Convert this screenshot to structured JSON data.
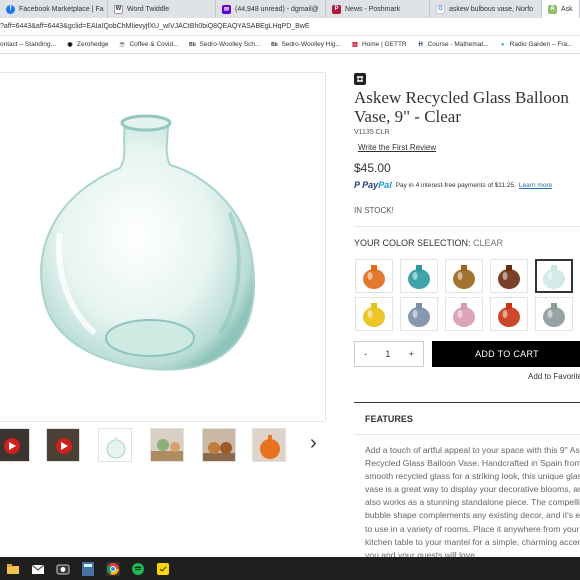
{
  "browser": {
    "tabs": [
      {
        "label": "Facebook Marketplace | Fa",
        "color": "#1877f2",
        "glyph": "f"
      },
      {
        "label": "Word Twiddle",
        "color": "#ffffff",
        "glyph": "W"
      },
      {
        "label": "(44,948 unread) - dgmail@",
        "color": "#6001d2",
        "glyph": "✉"
      },
      {
        "label": "News - Poshmark",
        "color": "#ac1a3a",
        "glyph": "P"
      },
      {
        "label": "askew bulbous vase, Norfo",
        "color": "#fbbc05",
        "glyph": "G"
      },
      {
        "label": "Ask",
        "color": "#8fbf6a",
        "glyph": "A"
      }
    ],
    "url": "?aff=6443&aff=6443&gclid=EAIaIQobChMIievyjfXU_wIVJACtBh0biQ8QEAQYASABEgLHqPD_BwE",
    "bookmarks": [
      {
        "label": "ontact – Standing..."
      },
      {
        "label": "Zerohedge"
      },
      {
        "label": "Coffee & Covid..."
      },
      {
        "label": "Sedro-Woolley Sch..."
      },
      {
        "label": "Sedro-Woolley Hig..."
      },
      {
        "label": "Home | GETTR"
      },
      {
        "label": "Course - Mathemat..."
      },
      {
        "label": "Radio Garden – Fra..."
      }
    ]
  },
  "product": {
    "title_line1": "Askew Recycled Glass Balloon",
    "title_line2": "Vase, 9\" - Clear",
    "sku": "V1135 CLR",
    "review_link": "Write the First Review",
    "price": "$45.00",
    "paypal_text": "Pay in 4 interest-free payments of $11.25.",
    "paypal_link": "Learn more",
    "stock": "IN STOCK!",
    "color_label": "YOUR COLOR SELECTION:",
    "color_value": "CLEAR",
    "swatches": [
      {
        "color": "#e06a1a",
        "selected": false
      },
      {
        "color": "#2a9aa0",
        "selected": false
      },
      {
        "color": "#9a6418",
        "selected": false
      },
      {
        "color": "#6a2c10",
        "selected": false
      },
      {
        "color": "#cfe8e4",
        "selected": true
      },
      {
        "color": "#e8c012",
        "selected": false
      },
      {
        "color": "#7a8ea8",
        "selected": false
      },
      {
        "color": "#d89ab0",
        "selected": false
      },
      {
        "color": "#c83414",
        "selected": false
      },
      {
        "color": "#8a9a98",
        "selected": false
      }
    ],
    "qty_minus": "-",
    "qty_value": "1",
    "qty_plus": "+",
    "add_to_cart": "ADD TO CART",
    "add_to_favorites": "Add to Favorites",
    "features_heading": "FEATURES",
    "description": "Add a touch of artful appeal to your space with this 9\" Askew Recycled Glass Balloon Vase. Handcrafted in Spain from smooth recycled glass for a striking look, this unique glass vase is a great way to display your decorative blooms, and it also works as a stunning standalone piece. The compelling bubble shape complements any existing decor, and it's easy to use in a variety of rooms. Place it anywhere from your kitchen table to your mantel for a simple, charming accent you and your guests will love."
  },
  "gallery": {
    "next_arrow": "›"
  }
}
